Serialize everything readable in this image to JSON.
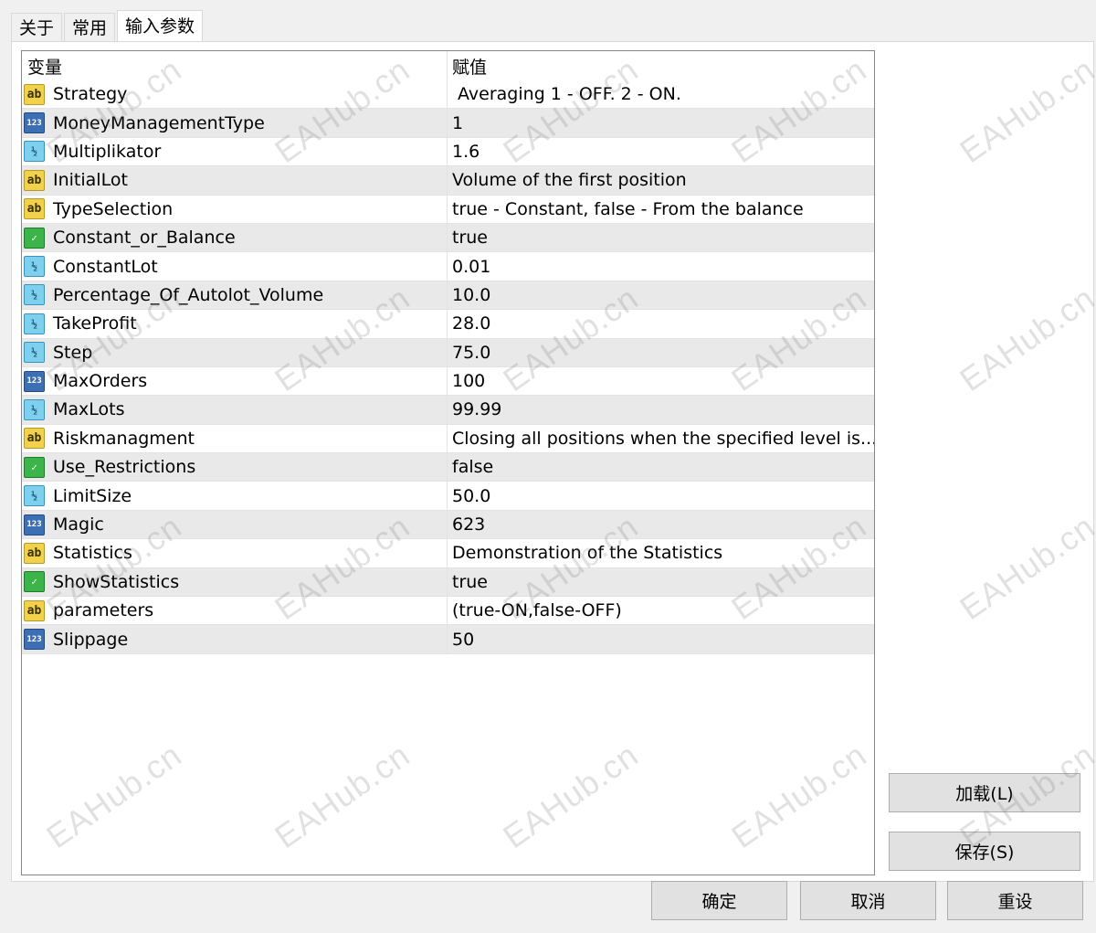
{
  "tabs": [
    {
      "label": "关于"
    },
    {
      "label": "常用"
    },
    {
      "label": "输入参数"
    }
  ],
  "grid": {
    "header": {
      "name": "变量",
      "value": "赋值"
    },
    "rows": [
      {
        "type": "string",
        "icon": "ab",
        "name": "Strategy",
        "value": " Averaging 1 - OFF. 2 - ON."
      },
      {
        "type": "int",
        "icon": "123",
        "name": "MoneyManagementType",
        "value": "1"
      },
      {
        "type": "double",
        "icon": "½",
        "name": "Multiplikator",
        "value": "1.6"
      },
      {
        "type": "string",
        "icon": "ab",
        "name": "InitialLot",
        "value": "Volume of the first position"
      },
      {
        "type": "string",
        "icon": "ab",
        "name": "TypeSelection",
        "value": "true - Constant, false - From the balance"
      },
      {
        "type": "bool",
        "icon": "✓",
        "name": "Constant_or_Balance",
        "value": "true"
      },
      {
        "type": "double",
        "icon": "½",
        "name": "ConstantLot",
        "value": "0.01"
      },
      {
        "type": "double",
        "icon": "½",
        "name": "Percentage_Of_Autolot_Volume",
        "value": "10.0"
      },
      {
        "type": "double",
        "icon": "½",
        "name": "TakeProfit",
        "value": "28.0"
      },
      {
        "type": "double",
        "icon": "½",
        "name": "Step",
        "value": "75.0"
      },
      {
        "type": "int",
        "icon": "123",
        "name": "MaxOrders",
        "value": "100"
      },
      {
        "type": "double",
        "icon": "½",
        "name": "MaxLots",
        "value": "99.99"
      },
      {
        "type": "string",
        "icon": "ab",
        "name": "Riskmanagment",
        "value": "Closing all positions when the specified level is..."
      },
      {
        "type": "bool",
        "icon": "✓",
        "name": "Use_Restrictions",
        "value": "false"
      },
      {
        "type": "double",
        "icon": "½",
        "name": "LimitSize",
        "value": "50.0"
      },
      {
        "type": "int",
        "icon": "123",
        "name": "Magic",
        "value": "623"
      },
      {
        "type": "string",
        "icon": "ab",
        "name": "Statistics",
        "value": "Demonstration of the Statistics"
      },
      {
        "type": "bool",
        "icon": "✓",
        "name": "ShowStatistics",
        "value": "true"
      },
      {
        "type": "string",
        "icon": "ab",
        "name": "parameters",
        "value": "(true-ON,false-OFF)"
      },
      {
        "type": "int",
        "icon": "123",
        "name": "Slippage",
        "value": "50"
      }
    ]
  },
  "side_buttons": {
    "load": "加载(L)",
    "save": "保存(S)"
  },
  "footer_buttons": {
    "ok": "确定",
    "cancel": "取消",
    "reset": "重设"
  },
  "watermark": {
    "text": "EAHub.cn"
  }
}
